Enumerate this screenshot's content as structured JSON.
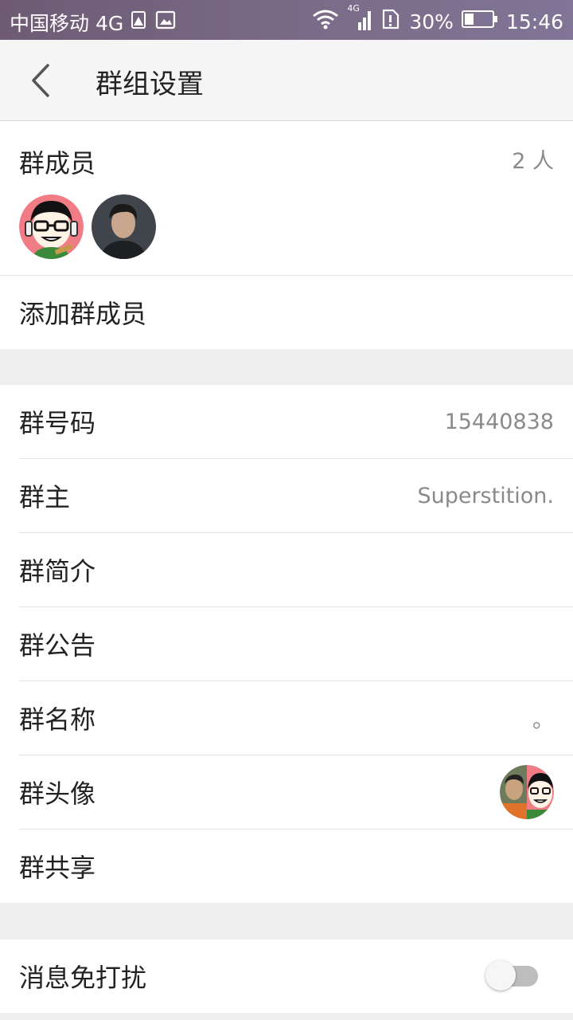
{
  "status_bar": {
    "carrier": "中国移动 4G",
    "network_badge": "4G",
    "battery": "30%",
    "time": "15:46",
    "icons": [
      "warning-icon",
      "image-icon",
      "wifi-icon",
      "signal-icon",
      "sim-icon",
      "battery-icon"
    ]
  },
  "header": {
    "title": "群组设置",
    "back_icon": "chevron-left-icon"
  },
  "members": {
    "label": "群成员",
    "count": "2 人",
    "avatars": [
      "cartoon-avatar",
      "photo-avatar"
    ]
  },
  "add_member": {
    "label": "添加群成员"
  },
  "info": {
    "group_number": {
      "label": "群号码",
      "value": "15440838"
    },
    "owner": {
      "label": "群主",
      "value": "Superstition."
    },
    "intro": {
      "label": "群简介"
    },
    "notice": {
      "label": "群公告"
    },
    "name": {
      "label": "群名称",
      "value": "。"
    },
    "avatar": {
      "label": "群头像"
    },
    "share": {
      "label": "群共享"
    }
  },
  "mute": {
    "label": "消息免打扰",
    "enabled": false
  },
  "colors": {
    "status_bar": "#75648a",
    "background": "#efefef",
    "text": "#222222",
    "secondary_text": "#8a8a8a",
    "toggle_off": "#bdbdbd"
  }
}
